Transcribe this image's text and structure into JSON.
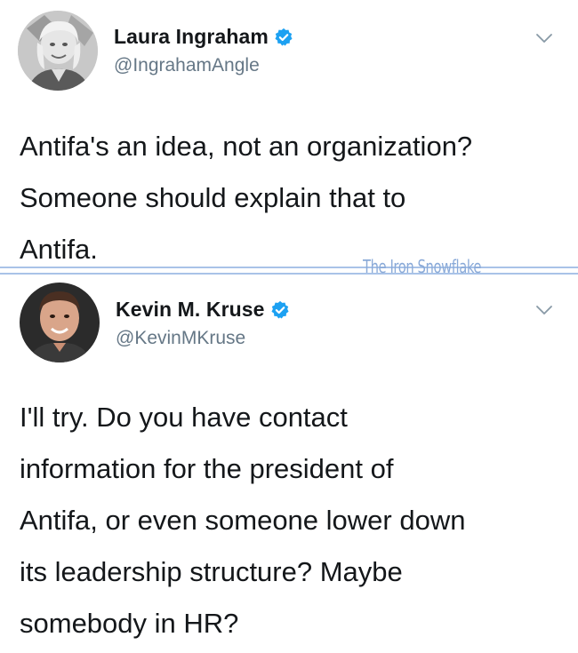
{
  "tweets": [
    {
      "display_name": "Laura Ingraham",
      "handle": "@IngrahamAngle",
      "verified": true,
      "text": "Antifa's an idea, not an organization?\nSomeone should explain that to\nAntifa."
    },
    {
      "display_name": "Kevin M. Kruse",
      "handle": "@KevinMKruse",
      "verified": true,
      "text": "I'll try. Do you have contact\ninformation for the president of\nAntifa, or even someone lower down\nits leadership structure? Maybe\nsomebody in HR?"
    }
  ],
  "watermark": "The Iron Snowflake",
  "colors": {
    "verified_badge": "#1da1f2",
    "handle_gray": "#657786",
    "divider_blue": "#a9c3e8",
    "watermark_blue": "#8aaad8"
  },
  "icons": {
    "verified": "verified-badge-icon",
    "menu": "chevron-down-icon"
  }
}
